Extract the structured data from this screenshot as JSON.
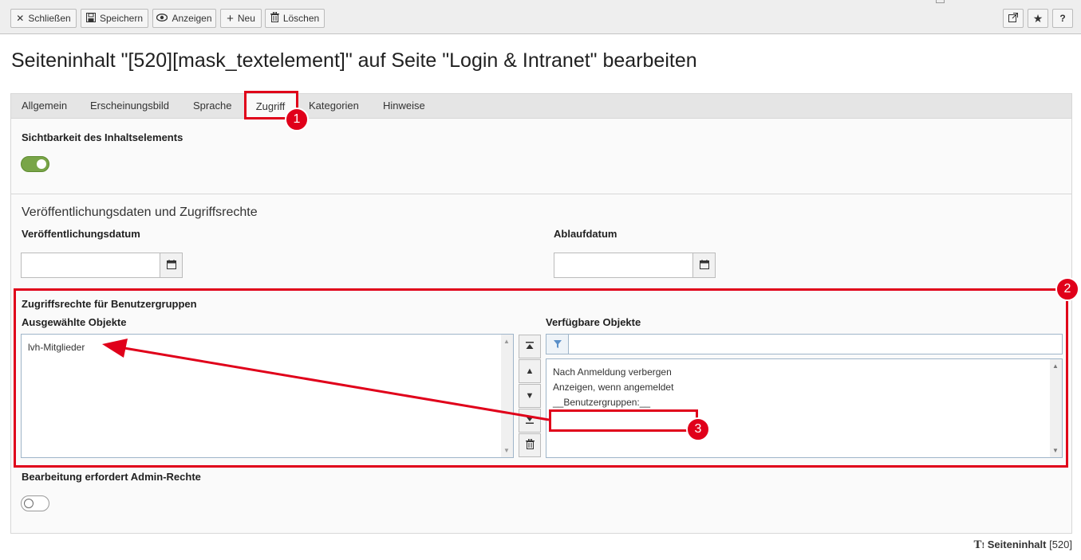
{
  "toolbar": {
    "close_label": "Schließen",
    "save_label": "Speichern",
    "view_label": "Anzeigen",
    "new_label": "Neu",
    "delete_label": "Löschen",
    "help_label": "?"
  },
  "page_title": "Seiteninhalt \"[520][mask_textelement]\" auf Seite \"Login & Intranet\" bearbeiten",
  "tabs": [
    {
      "label": "Allgemein"
    },
    {
      "label": "Erscheinungsbild"
    },
    {
      "label": "Sprache"
    },
    {
      "label": "Zugriff"
    },
    {
      "label": "Kategorien"
    },
    {
      "label": "Hinweise"
    }
  ],
  "visibility": {
    "label": "Sichtbarkeit des Inhaltselements",
    "enabled": true
  },
  "publish_section": {
    "title": "Veröffentlichungsdaten und Zugriffsrechte",
    "start_label": "Veröffentlichungsdatum",
    "start_value": "",
    "end_label": "Ablaufdatum",
    "end_value": ""
  },
  "usergroups": {
    "label": "Zugriffsrechte für Benutzergruppen",
    "selected_label": "Ausgewählte Objekte",
    "selected_items": [
      "lvh-Mitglieder"
    ],
    "available_label": "Verfügbare Objekte",
    "filter_value": "",
    "available_items": [
      "Nach Anmeldung verbergen",
      "Anzeigen, wenn angemeldet",
      "__Benutzergruppen:__"
    ]
  },
  "admin_only": {
    "label": "Bearbeitung erfordert Admin-Rechte",
    "enabled": false
  },
  "annotations": {
    "badge1": "1",
    "badge2": "2",
    "badge3": "3",
    "color": "#e0001a"
  },
  "footer": {
    "record_type": "Seiteninhalt",
    "record_id": "[520]"
  }
}
